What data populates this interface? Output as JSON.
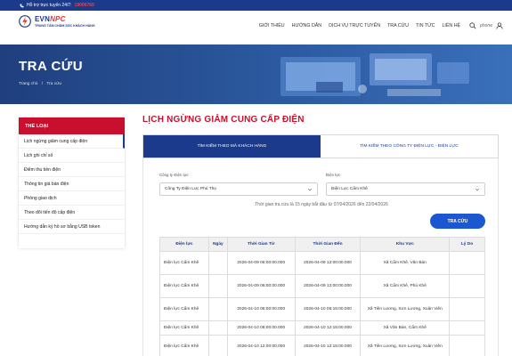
{
  "topbar": {
    "support_label": "Hỗ trợ trực tuyến 24/7:",
    "hotline": "19006769"
  },
  "logo": {
    "name_evn": "EVN",
    "name_npc": "NPC",
    "subtitle": "TRUNG TÂM CHĂM SÓC KHÁCH HÀNG"
  },
  "nav": {
    "items": [
      "GIỚI THIỆU",
      "HƯỚNG DẪN",
      "DỊCH VỤ TRỰC TUYẾN",
      "TRA CỨU",
      "TIN TỨC",
      "LIÊN HỆ"
    ],
    "phone_text": "phone"
  },
  "banner": {
    "title": "TRA CỨU",
    "breadcrumb_home": "Trang chủ",
    "breadcrumb_sep": "/",
    "breadcrumb_current": "Tra cứu"
  },
  "sidebar": {
    "heading": "THỂ LOẠI",
    "items": [
      "Lịch ngừng giảm cung cấp điện",
      "Lịch ghi chỉ số",
      "Điểm thu tiền điện",
      "Thông tin giá bán điện",
      "Phòng giao dịch",
      "Theo dõi tiến độ cấp điện",
      "Hướng dẫn ký hồ sơ bằng USB token"
    ]
  },
  "main": {
    "title": "LỊCH NGỪNG GIẢM CUNG CẤP ĐIỆN",
    "tab_active": "TÌM KIẾM THEO MÃ KHÁCH HÀNG",
    "tab_inactive": "TÌM KIẾM THEO CÔNG TY ĐIỆN LỰC - ĐIỆN LỰC",
    "company_label": "Công ty Điện lực",
    "company_value": "Công Ty Điện Lực Phú Thọ",
    "branch_label": "Điện lực",
    "branch_value": "Điện Lực Cẩm Khê",
    "note": "Thời gian tra cứu là 15 ngày bắt đầu từ 07/04/2026 đến 22/04/2026",
    "search_button": "TRA CỨU"
  },
  "table": {
    "headers": [
      "Điện lực",
      "Ngày",
      "Thời Gian Từ",
      "Thời Gian Đến",
      "Khu Vực",
      "Lý Do"
    ],
    "rows": [
      {
        "branch": "Điện lực Cẩm Khê",
        "date": "",
        "from": "2026-04-09 06:00:00.000",
        "to": "2026-04-09 12:00:00.000",
        "area": "Xã Cẩm Khê, Văn Bán",
        "reason": ""
      },
      {
        "branch": "Điện lực Cẩm Khê",
        "date": "",
        "from": "2026-04-09 06:00:00.000",
        "to": "2026-04-09 12:00:00.000",
        "area": "Xã Cẩm Khê, Phú Khê",
        "reason": ""
      },
      {
        "branch": "Điện lực Cẩm Khê",
        "date": "",
        "from": "2026-04-10 06:00:00.000",
        "to": "2026-04-10 06:15:00.000",
        "area": "Xã Tiên Lương, Sơn Lương, Xuân Viên",
        "reason": ""
      },
      {
        "branch": "Điện lực Cẩm Khê",
        "date": "",
        "from": "2026-04-10 06:00:00.000",
        "to": "2026-04-10 12:15:00.000",
        "area": "Xã Văn Bán, Cẩm Khê",
        "reason": ""
      },
      {
        "branch": "Điện lực Cẩm Khê",
        "date": "",
        "from": "2026-04-10 12:00:00.000",
        "to": "2026-04-10 12:15:00.000",
        "area": "Xã Tiên Lương, Sơn Lương, Xuân Viên",
        "reason": ""
      }
    ]
  },
  "colors": {
    "brand_blue": "#1b3a8c",
    "brand_red": "#c8102e",
    "button_blue": "#1b57d1"
  }
}
